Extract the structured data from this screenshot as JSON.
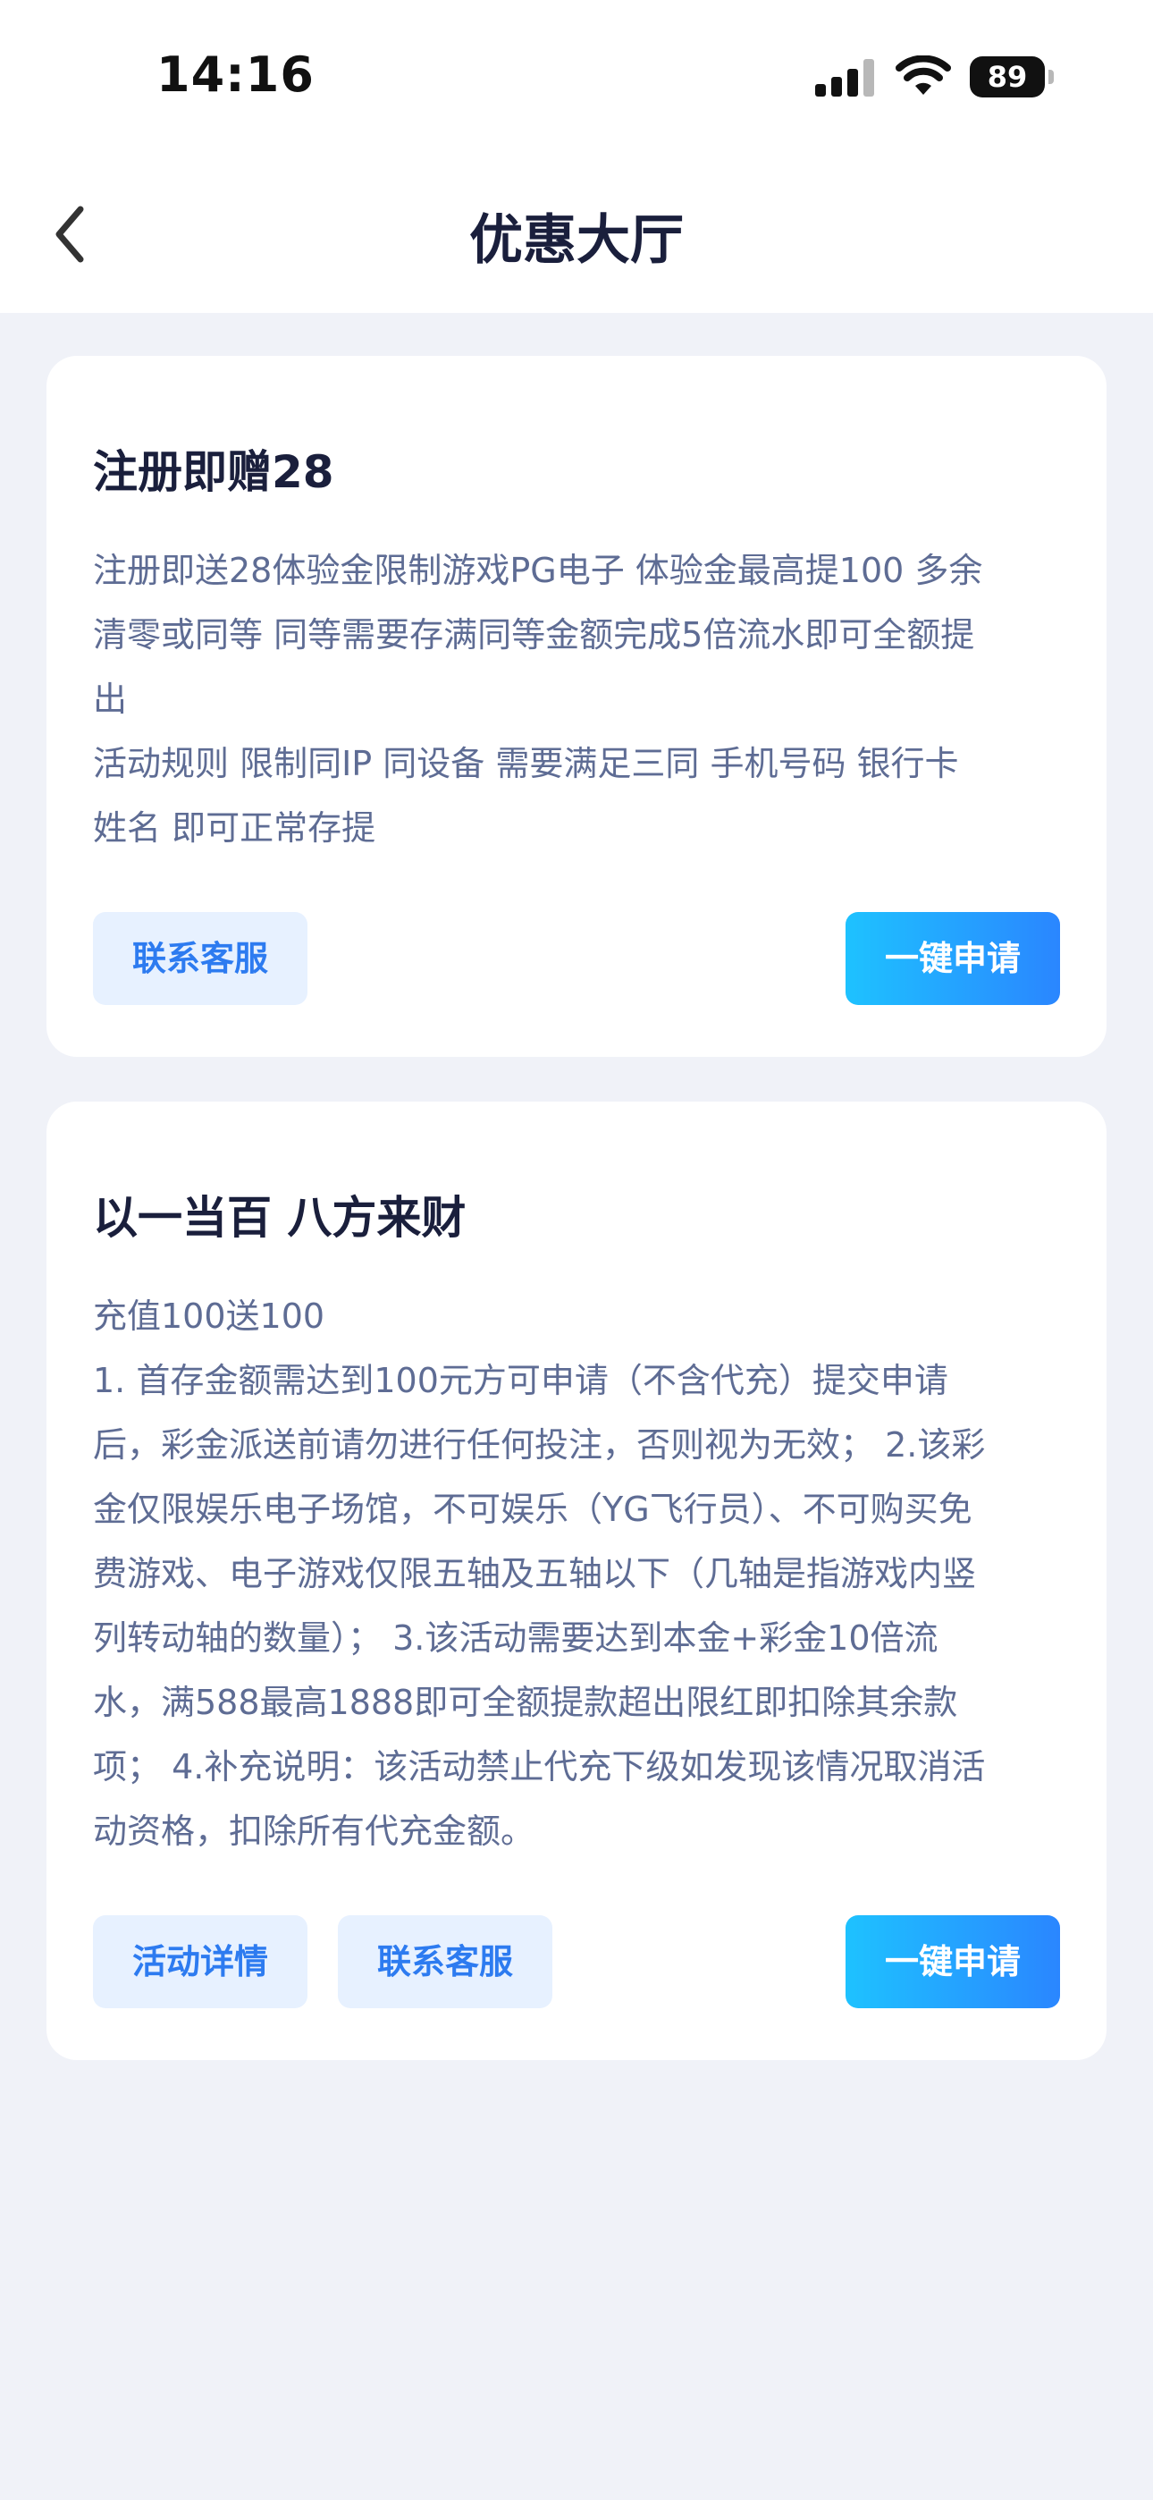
{
  "status_bar": {
    "time": "14:16",
    "battery": "89"
  },
  "nav": {
    "title": "优惠大厅"
  },
  "promotions": [
    {
      "title": "注册即赠28",
      "description_lines": [
        "注册即送28体验金限制游戏PG电子 体验金最高提100 多余",
        "清零或同等 同等需要存满同等金额完成5倍流水即可全额提",
        "出",
        "活动规则 限制同IP 同设备 需要满足三同 手机号码 银行卡",
        "姓名 即可正常存提"
      ],
      "contact_label": "联系客服",
      "apply_label": "一键申请"
    },
    {
      "title": "以一当百 八方来财",
      "description_lines": [
        "充值100送100",
        "1. 首存金额需达到100元方可申请（不含代充）提交申请",
        "后，彩金派送前请勿进行任何投注，否则视为无效； 2.该彩",
        "金仅限娱乐电子场馆，不可娱乐（YG飞行员）、不可购买免",
        "费游戏、电子游戏仅限五轴及五轴以下（几轴是指游戏内竖",
        "列转动轴的数量）； 3.该活动需要达到本金+彩金10倍流",
        "水，满588最高1888即可全额提款超出限红即扣除其余款",
        "项； 4.补充说明：该活动禁止代充下级如发现该情况取消活",
        "动资格，扣除所有代充金额。"
      ],
      "details_label": "活动详情",
      "contact_label": "联系客服",
      "apply_label": "一键申请"
    }
  ],
  "colors": {
    "page_bg": "#f0f2f8",
    "title_text": "#1a1f3c",
    "body_text": "#5e6c94",
    "soft_button_bg": "#e7f1ff",
    "soft_button_text": "#2d7bf0",
    "primary_gradient_start": "#1ec2ff",
    "primary_gradient_end": "#2a86ff"
  }
}
